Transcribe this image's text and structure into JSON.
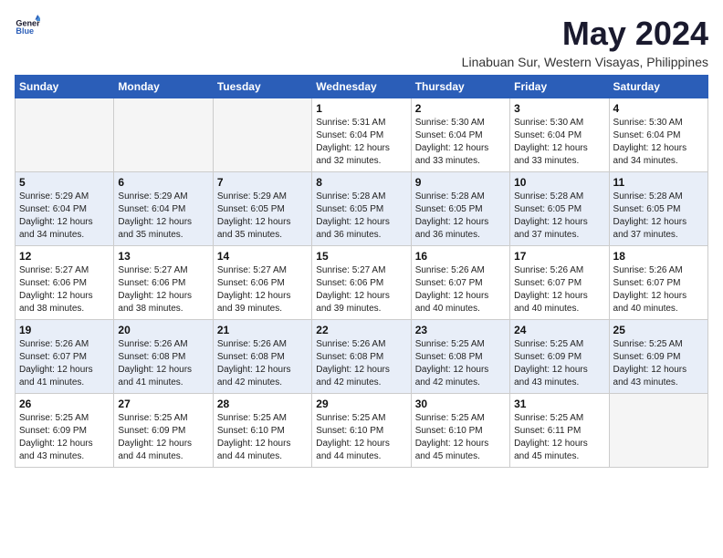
{
  "logo": {
    "line1": "General",
    "line2": "Blue"
  },
  "title": "May 2024",
  "subtitle": "Linabuan Sur, Western Visayas, Philippines",
  "days_of_week": [
    "Sunday",
    "Monday",
    "Tuesday",
    "Wednesday",
    "Thursday",
    "Friday",
    "Saturday"
  ],
  "weeks": [
    [
      {
        "day": "",
        "sunrise": "",
        "sunset": "",
        "daylight": ""
      },
      {
        "day": "",
        "sunrise": "",
        "sunset": "",
        "daylight": ""
      },
      {
        "day": "",
        "sunrise": "",
        "sunset": "",
        "daylight": ""
      },
      {
        "day": "1",
        "sunrise": "Sunrise: 5:31 AM",
        "sunset": "Sunset: 6:04 PM",
        "daylight": "Daylight: 12 hours and 32 minutes."
      },
      {
        "day": "2",
        "sunrise": "Sunrise: 5:30 AM",
        "sunset": "Sunset: 6:04 PM",
        "daylight": "Daylight: 12 hours and 33 minutes."
      },
      {
        "day": "3",
        "sunrise": "Sunrise: 5:30 AM",
        "sunset": "Sunset: 6:04 PM",
        "daylight": "Daylight: 12 hours and 33 minutes."
      },
      {
        "day": "4",
        "sunrise": "Sunrise: 5:30 AM",
        "sunset": "Sunset: 6:04 PM",
        "daylight": "Daylight: 12 hours and 34 minutes."
      }
    ],
    [
      {
        "day": "5",
        "sunrise": "Sunrise: 5:29 AM",
        "sunset": "Sunset: 6:04 PM",
        "daylight": "Daylight: 12 hours and 34 minutes."
      },
      {
        "day": "6",
        "sunrise": "Sunrise: 5:29 AM",
        "sunset": "Sunset: 6:04 PM",
        "daylight": "Daylight: 12 hours and 35 minutes."
      },
      {
        "day": "7",
        "sunrise": "Sunrise: 5:29 AM",
        "sunset": "Sunset: 6:05 PM",
        "daylight": "Daylight: 12 hours and 35 minutes."
      },
      {
        "day": "8",
        "sunrise": "Sunrise: 5:28 AM",
        "sunset": "Sunset: 6:05 PM",
        "daylight": "Daylight: 12 hours and 36 minutes."
      },
      {
        "day": "9",
        "sunrise": "Sunrise: 5:28 AM",
        "sunset": "Sunset: 6:05 PM",
        "daylight": "Daylight: 12 hours and 36 minutes."
      },
      {
        "day": "10",
        "sunrise": "Sunrise: 5:28 AM",
        "sunset": "Sunset: 6:05 PM",
        "daylight": "Daylight: 12 hours and 37 minutes."
      },
      {
        "day": "11",
        "sunrise": "Sunrise: 5:28 AM",
        "sunset": "Sunset: 6:05 PM",
        "daylight": "Daylight: 12 hours and 37 minutes."
      }
    ],
    [
      {
        "day": "12",
        "sunrise": "Sunrise: 5:27 AM",
        "sunset": "Sunset: 6:06 PM",
        "daylight": "Daylight: 12 hours and 38 minutes."
      },
      {
        "day": "13",
        "sunrise": "Sunrise: 5:27 AM",
        "sunset": "Sunset: 6:06 PM",
        "daylight": "Daylight: 12 hours and 38 minutes."
      },
      {
        "day": "14",
        "sunrise": "Sunrise: 5:27 AM",
        "sunset": "Sunset: 6:06 PM",
        "daylight": "Daylight: 12 hours and 39 minutes."
      },
      {
        "day": "15",
        "sunrise": "Sunrise: 5:27 AM",
        "sunset": "Sunset: 6:06 PM",
        "daylight": "Daylight: 12 hours and 39 minutes."
      },
      {
        "day": "16",
        "sunrise": "Sunrise: 5:26 AM",
        "sunset": "Sunset: 6:07 PM",
        "daylight": "Daylight: 12 hours and 40 minutes."
      },
      {
        "day": "17",
        "sunrise": "Sunrise: 5:26 AM",
        "sunset": "Sunset: 6:07 PM",
        "daylight": "Daylight: 12 hours and 40 minutes."
      },
      {
        "day": "18",
        "sunrise": "Sunrise: 5:26 AM",
        "sunset": "Sunset: 6:07 PM",
        "daylight": "Daylight: 12 hours and 40 minutes."
      }
    ],
    [
      {
        "day": "19",
        "sunrise": "Sunrise: 5:26 AM",
        "sunset": "Sunset: 6:07 PM",
        "daylight": "Daylight: 12 hours and 41 minutes."
      },
      {
        "day": "20",
        "sunrise": "Sunrise: 5:26 AM",
        "sunset": "Sunset: 6:08 PM",
        "daylight": "Daylight: 12 hours and 41 minutes."
      },
      {
        "day": "21",
        "sunrise": "Sunrise: 5:26 AM",
        "sunset": "Sunset: 6:08 PM",
        "daylight": "Daylight: 12 hours and 42 minutes."
      },
      {
        "day": "22",
        "sunrise": "Sunrise: 5:26 AM",
        "sunset": "Sunset: 6:08 PM",
        "daylight": "Daylight: 12 hours and 42 minutes."
      },
      {
        "day": "23",
        "sunrise": "Sunrise: 5:25 AM",
        "sunset": "Sunset: 6:08 PM",
        "daylight": "Daylight: 12 hours and 42 minutes."
      },
      {
        "day": "24",
        "sunrise": "Sunrise: 5:25 AM",
        "sunset": "Sunset: 6:09 PM",
        "daylight": "Daylight: 12 hours and 43 minutes."
      },
      {
        "day": "25",
        "sunrise": "Sunrise: 5:25 AM",
        "sunset": "Sunset: 6:09 PM",
        "daylight": "Daylight: 12 hours and 43 minutes."
      }
    ],
    [
      {
        "day": "26",
        "sunrise": "Sunrise: 5:25 AM",
        "sunset": "Sunset: 6:09 PM",
        "daylight": "Daylight: 12 hours and 43 minutes."
      },
      {
        "day": "27",
        "sunrise": "Sunrise: 5:25 AM",
        "sunset": "Sunset: 6:09 PM",
        "daylight": "Daylight: 12 hours and 44 minutes."
      },
      {
        "day": "28",
        "sunrise": "Sunrise: 5:25 AM",
        "sunset": "Sunset: 6:10 PM",
        "daylight": "Daylight: 12 hours and 44 minutes."
      },
      {
        "day": "29",
        "sunrise": "Sunrise: 5:25 AM",
        "sunset": "Sunset: 6:10 PM",
        "daylight": "Daylight: 12 hours and 44 minutes."
      },
      {
        "day": "30",
        "sunrise": "Sunrise: 5:25 AM",
        "sunset": "Sunset: 6:10 PM",
        "daylight": "Daylight: 12 hours and 45 minutes."
      },
      {
        "day": "31",
        "sunrise": "Sunrise: 5:25 AM",
        "sunset": "Sunset: 6:11 PM",
        "daylight": "Daylight: 12 hours and 45 minutes."
      },
      {
        "day": "",
        "sunrise": "",
        "sunset": "",
        "daylight": ""
      }
    ]
  ]
}
